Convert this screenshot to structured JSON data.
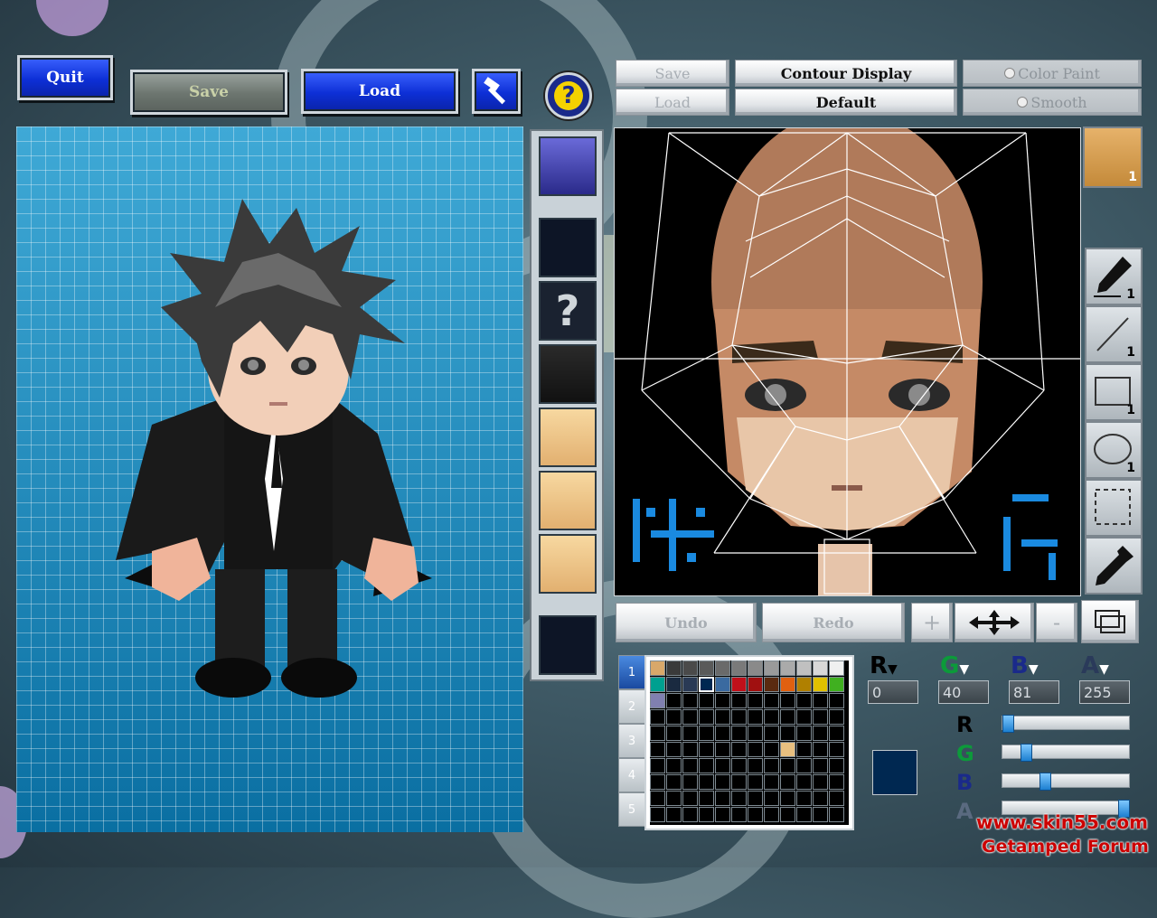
{
  "toolbar": {
    "quit_label": "Quit",
    "save_label": "Save",
    "load_label": "Load"
  },
  "editor_controls": {
    "save_label": "Save",
    "load_label": "Load",
    "contour_display_label": "Contour Display",
    "default_label": "Default",
    "color_paint_label": "Color Paint",
    "smooth_label": "Smooth"
  },
  "portrait_badge": "1",
  "tools": [
    {
      "name": "pen",
      "count": "1"
    },
    {
      "name": "line",
      "count": "1"
    },
    {
      "name": "rectangle",
      "count": "1"
    },
    {
      "name": "ellipse",
      "count": "1"
    },
    {
      "name": "selection",
      "count": ""
    },
    {
      "name": "eyedropper",
      "count": ""
    }
  ],
  "history": {
    "undo_label": "Undo",
    "redo_label": "Redo"
  },
  "palette_tabs": [
    "1",
    "2",
    "3",
    "4",
    "5"
  ],
  "channels": {
    "r_label": "R",
    "g_label": "G",
    "b_label": "B",
    "a_label": "A",
    "r_value": "0",
    "g_value": "40",
    "b_value": "81",
    "a_value": "255",
    "r_level": 0.0,
    "g_level": 0.157,
    "b_level": 0.318,
    "a_level": 1.0
  },
  "current_color": "#002851",
  "palette_colors": [
    "#d9a86a",
    "#3a3a3a",
    "#4a4a4a",
    "#5a5a5a",
    "#6a6a6a",
    "#7a7a7a",
    "#8a8a8a",
    "#9a9a9a",
    "#aaaaaa",
    "#c0c0c0",
    "#d8d8d8",
    "#f0f0f0",
    "#00a090",
    "#1a2a40",
    "#2a3a55",
    "#002851",
    "#3a6aa0",
    "#c0101a",
    "#a01010",
    "#5a2a10",
    "#e06010",
    "#b08000",
    "#e0c000",
    "#40b020",
    "#8080b0"
  ],
  "watermark": {
    "url": "www.skin55.com",
    "forum": "Getamped Forum"
  }
}
